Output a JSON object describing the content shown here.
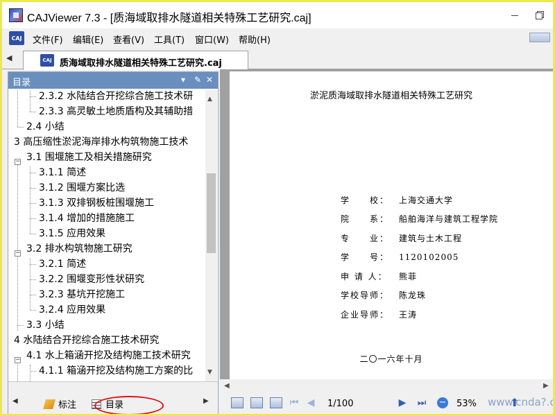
{
  "window": {
    "title": "CAJViewer 7.3 - [质海域取排水隧道相关特殊工艺研究.caj]"
  },
  "menu": {
    "items": [
      "文件(F)",
      "编辑(E)",
      "查看(V)",
      "工具(T)",
      "窗口(W)",
      "帮助(H)"
    ]
  },
  "tabs": {
    "active_label": "质海域取排水隧道相关特殊工艺研究.caj"
  },
  "toc": {
    "title": "目录",
    "items": [
      "2.3.2 水陆结合开挖综合施工技术研",
      "2.3.3 高灵敏土地质盾构及其辅助措",
      "2.4 小结",
      "3 高压缩性淤泥海岸排水构筑物施工技术",
      "3.1 围堰施工及相关措施研究",
      "3.1.1 简述",
      "3.1.2 围堰方案比选",
      "3.1.3 双排钢板桩围堰施工",
      "3.1.4 增加的措施施工",
      "3.1.5 应用效果",
      "3.2 排水构筑物施工研究",
      "3.2.1 简述",
      "3.2.2 围堰变形性状研究",
      "3.2.3 基坑开挖施工",
      "3.2.4 应用效果",
      "3.3 小结",
      "4 水陆结合开挖综合施工技术研究",
      "4.1 水上箱涵开挖及结构施工技术研究",
      "4.1.1 箱涵开挖及结构施工方案的比"
    ],
    "footer": {
      "annotation_tab": "标注",
      "contents_tab": "目录"
    }
  },
  "document": {
    "title": "淤泥质海域取排水隧道相关特殊工艺研究",
    "info": [
      {
        "label": "学　　校：",
        "value": "上海交通大学"
      },
      {
        "label": "院　　系：",
        "value": "船舶海洋与建筑工程学院"
      },
      {
        "label": "专　　业：",
        "value": "建筑与土木工程"
      },
      {
        "label": "学　　号：",
        "value": "1120102005"
      },
      {
        "label": "申 请 人：",
        "value": "熊菲"
      },
      {
        "label": "学校导师：",
        "value": "陈龙珠"
      },
      {
        "label": "企业导师：",
        "value": "王涛"
      }
    ],
    "date": "二〇一六年十月"
  },
  "statusbar": {
    "page_counter": "1/100",
    "zoom": "53%",
    "watermark": "www.cnda?.com"
  },
  "colors": {
    "frame": "#f0e84a",
    "panel_header": "#6a8fbf",
    "highlight_circle": "#e01010",
    "nav_blue": "#2f5fb8"
  }
}
